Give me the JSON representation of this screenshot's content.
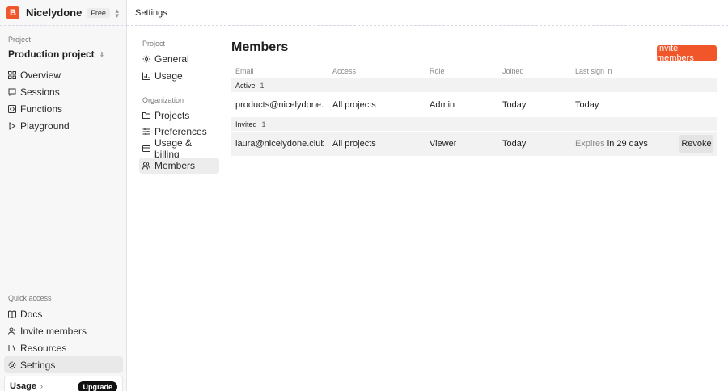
{
  "brand": {
    "initial": "B",
    "name": "Nicelydone",
    "plan": "Free"
  },
  "header": {
    "title": "Settings"
  },
  "sidebar": {
    "project_label": "Project",
    "project_name": "Production project",
    "items": [
      {
        "label": "Overview",
        "icon": "grid-icon"
      },
      {
        "label": "Sessions",
        "icon": "chat-icon"
      },
      {
        "label": "Functions",
        "icon": "code-icon"
      },
      {
        "label": "Playground",
        "icon": "play-icon"
      }
    ],
    "quick_label": "Quick access",
    "quick_items": [
      {
        "label": "Docs",
        "icon": "book-icon"
      },
      {
        "label": "Invite members",
        "icon": "user-plus-icon"
      },
      {
        "label": "Resources",
        "icon": "library-icon"
      },
      {
        "label": "Settings",
        "icon": "gear-icon"
      }
    ],
    "usage": {
      "label": "Usage",
      "upgrade": "Upgrade"
    }
  },
  "subnav": {
    "project_label": "Project",
    "project_items": [
      {
        "label": "General",
        "icon": "gear-icon"
      },
      {
        "label": "Usage",
        "icon": "bar-chart-icon"
      }
    ],
    "org_label": "Organization",
    "org_items": [
      {
        "label": "Projects",
        "icon": "folder-icon"
      },
      {
        "label": "Preferences",
        "icon": "sliders-icon"
      },
      {
        "label": "Usage & billing",
        "icon": "credit-card-icon"
      },
      {
        "label": "Members",
        "icon": "users-icon"
      }
    ]
  },
  "main": {
    "title": "Members",
    "invite_label": "Invite members",
    "columns": [
      "Email",
      "Access",
      "Role",
      "Joined",
      "Last sign in"
    ],
    "groups": [
      {
        "label": "Active",
        "count": "1",
        "rows": [
          {
            "email": "products@nicelydone.club",
            "access": "All projects",
            "role": "Admin",
            "joined": "Today",
            "last_prefix": "",
            "last": "Today"
          }
        ]
      },
      {
        "label": "Invited",
        "count": "1",
        "rows": [
          {
            "email": "laura@nicelydone.club",
            "access": "All projects",
            "role": "Viewer",
            "joined": "Today",
            "last_prefix": "Expires",
            "last": "in 29 days",
            "action": "Revoke"
          }
        ]
      }
    ]
  },
  "colors": {
    "accent": "#f0562a",
    "sidebar_bg": "#f7f7f7"
  }
}
